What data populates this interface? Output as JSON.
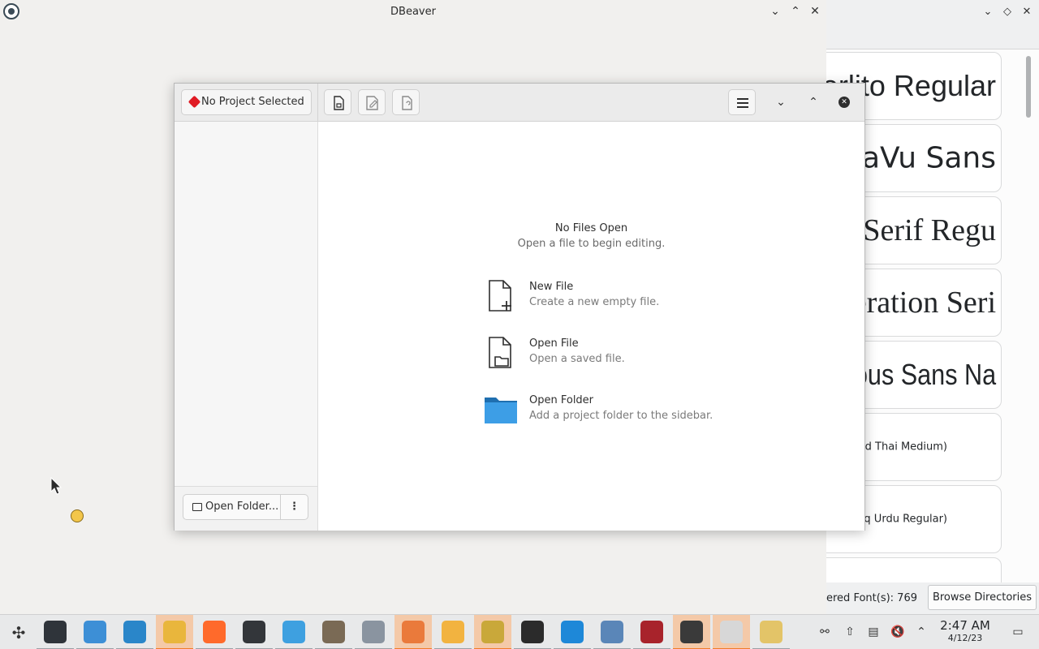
{
  "dbeaver": {
    "title": "DBeaver"
  },
  "editor": {
    "project_label": "No Project Selected",
    "empty_title": "No Files Open",
    "empty_subtitle": "Open a file to begin editing.",
    "actions": [
      {
        "title": "New File",
        "desc": "Create a new empty file.",
        "icon": "new-file-icon"
      },
      {
        "title": "Open File",
        "desc": "Open a saved file.",
        "icon": "open-file-icon"
      },
      {
        "title": "Open Folder",
        "desc": "Add a project folder to the sidebar.",
        "icon": "folder-icon"
      }
    ],
    "open_folder_label": "Open Folder...",
    "more_label": "⋮"
  },
  "font_viewer": {
    "cards": [
      {
        "text": "erlito Regular",
        "font": "Liberation Sans"
      },
      {
        "text": "aVu  Sans",
        "font": "DejaVu Sans"
      },
      {
        "text": "Serif Regu",
        "font": "Liberation Serif"
      },
      {
        "text": "eration Seri",
        "font": "Liberation Serif"
      },
      {
        "text": "ous Sans Na",
        "font": "Liberation Sans"
      },
      {
        "text": "ed Thai Medium)",
        "font": "DejaVu Sans"
      },
      {
        "text": "aliq Urdu Regular)",
        "font": "DejaVu Sans"
      },
      {
        "text": "",
        "font": "DejaVu Sans"
      }
    ],
    "count_label": "ered Font(s): 769",
    "browse_label": "Browse Directories"
  },
  "taskbar": {
    "time": "2:47 AM",
    "date": "4/12/23",
    "apps": [
      {
        "name": "settings-app",
        "color": "#2f343a"
      },
      {
        "name": "store-app",
        "color": "#3d8fd6"
      },
      {
        "name": "files-app",
        "color": "#2a86c9"
      },
      {
        "name": "sunflower-app",
        "color": "#e9b63c"
      },
      {
        "name": "firefox-app",
        "color": "#ff6a2b"
      },
      {
        "name": "terminal-app",
        "color": "#33363a"
      },
      {
        "name": "home-folder-app",
        "color": "#3ea0e0"
      },
      {
        "name": "gimp-app",
        "color": "#7a6a55"
      },
      {
        "name": "document-app",
        "color": "#8a94a0"
      },
      {
        "name": "presentation-app",
        "color": "#ea7a3b"
      },
      {
        "name": "bee-app",
        "color": "#f2b340"
      },
      {
        "name": "magnifier-app",
        "color": "#c9a83a"
      },
      {
        "name": "inkscape-app",
        "color": "#2b2b2b"
      },
      {
        "name": "info-app",
        "color": "#1e88d8"
      },
      {
        "name": "gear-app",
        "color": "#5a86b8"
      },
      {
        "name": "flag-app",
        "color": "#a8232b"
      },
      {
        "name": "penguin-app",
        "color": "#3a3a3a"
      },
      {
        "name": "code-editor-app",
        "color": "#d7d7d7"
      },
      {
        "name": "dbeaver-app",
        "color": "#e3c468"
      }
    ]
  }
}
